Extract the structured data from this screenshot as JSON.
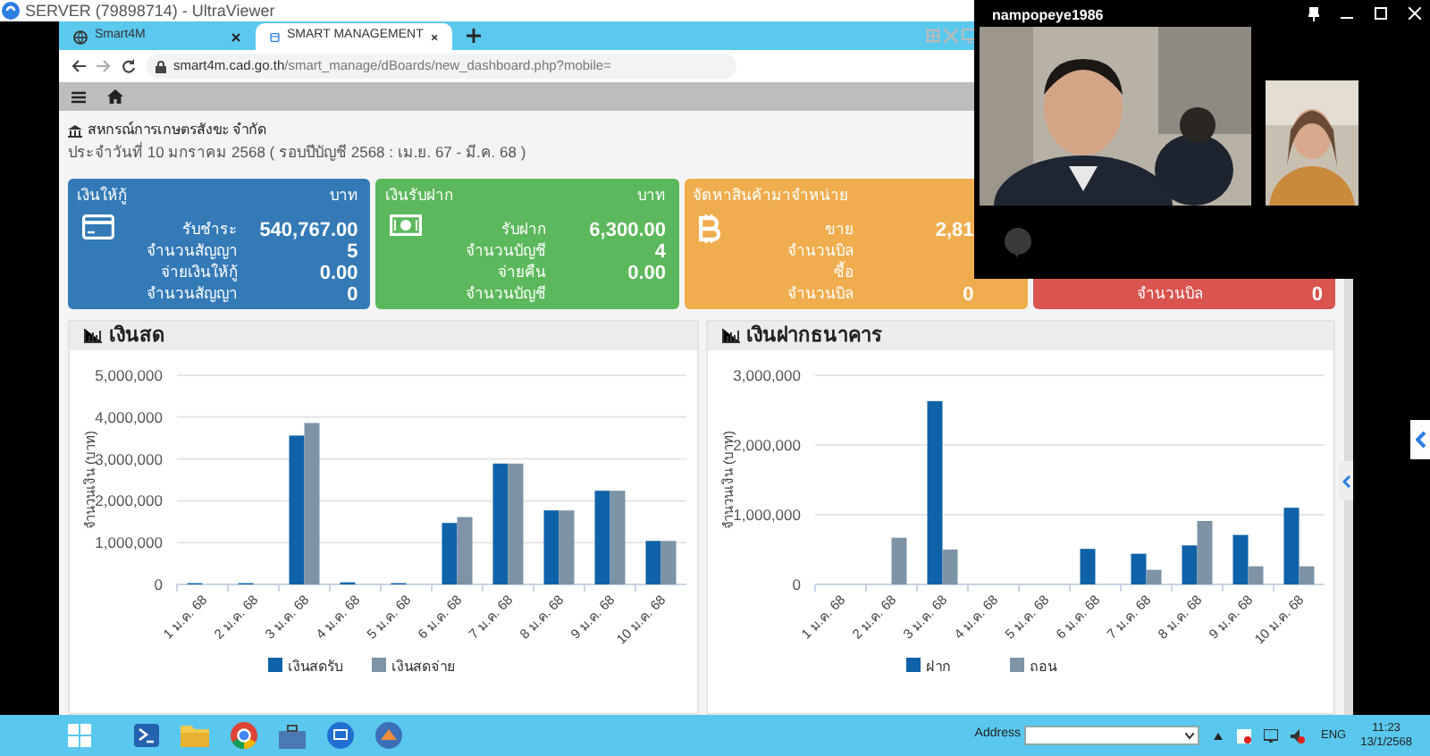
{
  "app_window": {
    "title": "SERVER (79898714) - UltraViewer"
  },
  "browser": {
    "tabs": [
      {
        "label": "Smart4M",
        "selected": false
      },
      {
        "label": "SMART MANAGEMENT",
        "selected": true
      }
    ],
    "url_host": "smart4m.cad.go.th",
    "url_path": "/smart_manage/dBoards/new_dashboard.php?mobile="
  },
  "page": {
    "org_name": "สหกรณ์การเกษตรสังขะ จำกัด",
    "date_line": "ประจำวันที่ 10 มกราคม 2568 ( รอบปีบัญชี 2568 : เม.ย. 67 - มี.ค. 68 )"
  },
  "cards": [
    {
      "title": "เงินให้กู้",
      "unit": "บาท",
      "color": "#337ab7",
      "rows": [
        {
          "label": "รับชำระ",
          "value": "540,767.00"
        },
        {
          "label": "จำนวนสัญญา",
          "value": "5"
        },
        {
          "label": "จ่ายเงินให้กู้",
          "value": "0.00"
        },
        {
          "label": "จำนวนสัญญา",
          "value": "0"
        }
      ]
    },
    {
      "title": "เงินรับฝาก",
      "unit": "บาท",
      "color": "#5cb85c",
      "rows": [
        {
          "label": "รับฝาก",
          "value": "6,300.00"
        },
        {
          "label": "จำนวนบัญชี",
          "value": "4"
        },
        {
          "label": "จ่ายคืน",
          "value": "0.00"
        },
        {
          "label": "จำนวนบัญชี"
        }
      ]
    },
    {
      "title": "จัดหาสินค้ามาจำหน่าย",
      "color": "#f0ad4e",
      "rows": [
        {
          "label": "ขาย",
          "value": "2,81"
        },
        {
          "label": "จำนวนบิล"
        },
        {
          "label": "ซื้อ"
        },
        {
          "label": "จำนวนบิล",
          "value": "0"
        }
      ]
    },
    {
      "color": "#d9534f",
      "rows": [
        {
          "label": "จำนวนบิล",
          "value": "0"
        }
      ]
    }
  ],
  "charts": [
    {
      "title": "เงินสด",
      "chart_data": {
        "type": "bar",
        "grid": true,
        "legend": true,
        "ylabel": "จำนวนเงิน (บาท)",
        "categories": [
          "1 ม.ค. 68",
          "2 ม.ค. 68",
          "3 ม.ค. 68",
          "4 ม.ค. 68",
          "5 ม.ค. 68",
          "6 ม.ค. 68",
          "7 ม.ค. 68",
          "8 ม.ค. 68",
          "9 ม.ค. 68",
          "10 ม.ค. 68"
        ],
        "ylim": [
          0,
          5000000
        ],
        "yticks": [
          {
            "value": 0,
            "label": "0"
          },
          {
            "value": 1000000,
            "label": "1,000,000"
          },
          {
            "value": 2000000,
            "label": "2,000,000"
          },
          {
            "value": 3000000,
            "label": "3,000,000"
          },
          {
            "value": 4000000,
            "label": "4,000,000"
          },
          {
            "value": 5000000,
            "label": "5,000,000"
          }
        ],
        "series": [
          {
            "name": "เงินสดรับ",
            "color": "#0f62a8",
            "values": [
              30000,
              30000,
              3560000,
              50000,
              30000,
              1470000,
              2890000,
              1770000,
              2240000,
              1040000
            ]
          },
          {
            "name": "เงินสดจ่าย",
            "color": "#7d93a6",
            "values": [
              0,
              0,
              3860000,
              0,
              0,
              1610000,
              2890000,
              1770000,
              2240000,
              1040000
            ]
          }
        ]
      }
    },
    {
      "title": "เงินฝากธนาคาร",
      "chart_data": {
        "type": "bar",
        "grid": true,
        "legend": true,
        "ylabel": "จำนวนเงิน (บาท)",
        "categories": [
          "1 ม.ค. 68",
          "2 ม.ค. 68",
          "3 ม.ค. 68",
          "4 ม.ค. 68",
          "5 ม.ค. 68",
          "6 ม.ค. 68",
          "7 ม.ค. 68",
          "8 ม.ค. 68",
          "9 ม.ค. 68",
          "10 ม.ค. 68"
        ],
        "ylim": [
          0,
          3000000
        ],
        "yticks": [
          {
            "value": 0,
            "label": "0"
          },
          {
            "value": 1000000,
            "label": "1,000,000"
          },
          {
            "value": 2000000,
            "label": "2,000,000"
          },
          {
            "value": 3000000,
            "label": "3,000,000"
          }
        ],
        "series": [
          {
            "name": "ฝาก",
            "color": "#0f62a8",
            "values": [
              0,
              0,
              2630000,
              0,
              0,
              510000,
              440000,
              560000,
              710000,
              1100000
            ]
          },
          {
            "name": "ถอน",
            "color": "#7d93a6",
            "values": [
              0,
              670000,
              500000,
              0,
              0,
              0,
              210000,
              910000,
              260000,
              260000
            ]
          }
        ]
      }
    }
  ],
  "video_call": {
    "title": "nampopeye1986"
  },
  "taskbar": {
    "address_label": "Address",
    "language": "ENG",
    "time": "11:23",
    "date": "13/1/2568"
  }
}
